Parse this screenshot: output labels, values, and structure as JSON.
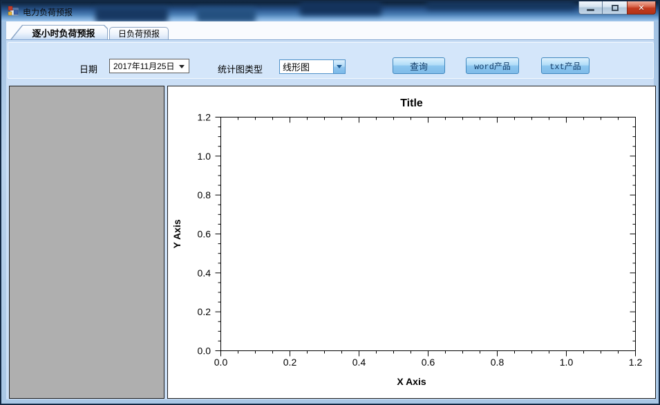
{
  "window": {
    "title": "电力负荷预报",
    "controls": {
      "close_glyph": "✕"
    }
  },
  "tabs": [
    {
      "label": "逐小时负荷预报",
      "selected": true
    },
    {
      "label": "日负荷预报",
      "selected": false
    }
  ],
  "toolbar": {
    "date_label": "日期",
    "date_value": "2017年11月25日",
    "chart_type_label": "统计图类型",
    "chart_type_value": "线形图",
    "query_button": "查询",
    "word_button": "word产品",
    "txt_button": "txt产品"
  },
  "colors": {
    "accent_border": "#3F87BE",
    "tabpage_bg": "#CBDFF6",
    "left_panel_bg": "#AFAFAF",
    "chart_bg": "#FFFFFF",
    "axis_color": "#000000",
    "close_button_red": "#C23A20"
  },
  "chart_data": {
    "type": "line",
    "title": "Title",
    "xlabel": "X Axis",
    "ylabel": "Y Axis",
    "xlim": [
      0,
      1.2
    ],
    "ylim": [
      0,
      1.2
    ],
    "x_major_step": 0.2,
    "x_minor_step": 0.05,
    "y_major_step": 0.2,
    "y_minor_step": 0.05,
    "x_tick_labels": [
      "0.0",
      "0.2",
      "0.4",
      "0.6",
      "0.8",
      "1.0",
      "1.2"
    ],
    "y_tick_labels": [
      "0.0",
      "0.2",
      "0.4",
      "0.6",
      "0.8",
      "1.0",
      "1.2"
    ],
    "grid": false,
    "legend": false,
    "series": []
  }
}
